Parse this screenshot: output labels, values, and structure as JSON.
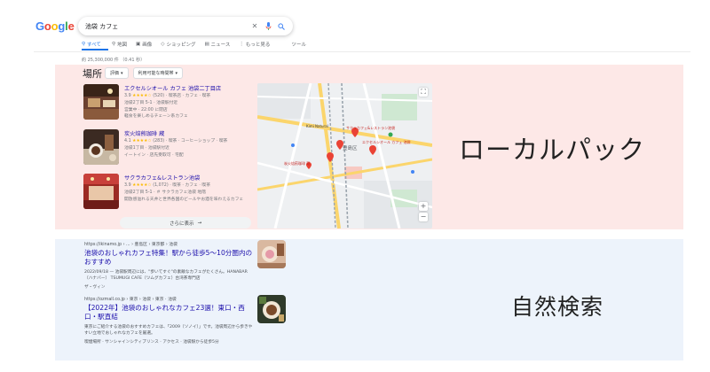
{
  "logo": {
    "letters": [
      "G",
      "o",
      "o",
      "g",
      "l",
      "e"
    ],
    "colors": [
      "#4285F4",
      "#EA4335",
      "#FBBC05",
      "#4285F4",
      "#34A853",
      "#EA4335"
    ]
  },
  "search": {
    "query": "池袋 カフェ",
    "clear_icon": "close-icon",
    "mic_icon": "mic-icon",
    "search_icon": "search-icon"
  },
  "tabs": [
    {
      "label": "すべて",
      "icon": "search-icon"
    },
    {
      "label": "地図",
      "icon": "map-pin-icon"
    },
    {
      "label": "画像",
      "icon": "image-icon"
    },
    {
      "label": "ショッピング",
      "icon": "tag-icon"
    },
    {
      "label": "ニュース",
      "icon": "news-icon"
    },
    {
      "label": "もっと見る",
      "icon": "more-icon"
    }
  ],
  "tools_label": "ツール",
  "result_stats": "約 25,300,000 件 （0.41 秒）",
  "local_pack": {
    "section_title": "場所",
    "filters": [
      "評価",
      "利用可能な時間帯"
    ],
    "places": [
      {
        "name": "エクセルシオール カフェ 池袋二丁目店",
        "rating": "3.9",
        "stars": "★★★★☆",
        "meta": "(520) · 喫茶店 · カフェ · 喫茶",
        "line2": "池袋2丁目 5-1 · 池袋駅付近",
        "line3": "営業中 · 22:00 に閉店",
        "line4": "軽食を楽しめるチェーン系カフェ"
      },
      {
        "name": "炭火焙煎珈琲 蔵",
        "rating": "4.1",
        "stars": "★★★★☆",
        "meta": "(283) · 喫茶 · コーヒーショップ · 喫茶",
        "line2": "池袋1丁目 · 池袋駅付近",
        "line3": "イートイン · 店先受取可 · 宅配",
        "line4": ""
      },
      {
        "name": "サクラカフェ&レストラン池袋",
        "rating": "3.9",
        "stars": "★★★★☆",
        "meta": "(1,072) · 喫茶 · カフェ · 喫茶",
        "line2": "池袋2丁目 5-1 · ＃ サクラカフェ池袋 地階",
        "line3": "開放感溢れる天井と世界各国のビールやお酒を味わえるカフェ",
        "line4": ""
      }
    ],
    "more_button": "さらに表示",
    "map": {
      "district_label": "豊島区",
      "pin_labels": [
        "サクラカフェ&レストラン池袋",
        "エクセルシオール カフェ 池袋",
        "炭火焙煎珈琲 蔵",
        "Kimi Natural"
      ],
      "fullscreen_icon": "fullscreen-icon",
      "zoom_in": "+",
      "zoom_out": "−"
    }
  },
  "label_local_pack": "ローカルパック",
  "organic": [
    {
      "url": "https://ikinamo.jp › ... › 豊島区 › 東京都 › 池袋",
      "title": "池袋のおしゃれカフェ特集！駅から徒歩5〜10分圏内のおすすめ",
      "snippet": "2022/09/18 — 池袋駅周辺には、\"歩いてすぐ\"の素敵なカフェがたくさん。HANABAR（ハナバー） TSUMUGI CAFE（ツムグカフェ）台湾茶専門店",
      "sitelinks": "ザ・ヴィン"
    },
    {
      "url": "https://ozmall.co.jp › 東京 › 池袋 › 東京 · 池袋",
      "title": "【2022年】池袋のおしゃれなカフェ23選！東口・西口・駅直結",
      "snippet": "東京にご紹介する池袋のおすすめカフェは、「2009（ソノイ）」です。池袋周辺から歩きやすい立地でおしゃれなカフェを厳選。",
      "sitelinks": "喫煙場所 · サンシャインシティプリンス · アクセス · 池袋駅から徒歩5分"
    }
  ],
  "label_organic": "自然検索",
  "colors": {
    "local_bg": "#FDE8E7",
    "organic_bg": "#EDF3FB",
    "link": "#1A0DAB",
    "accent": "#1A73E8"
  }
}
